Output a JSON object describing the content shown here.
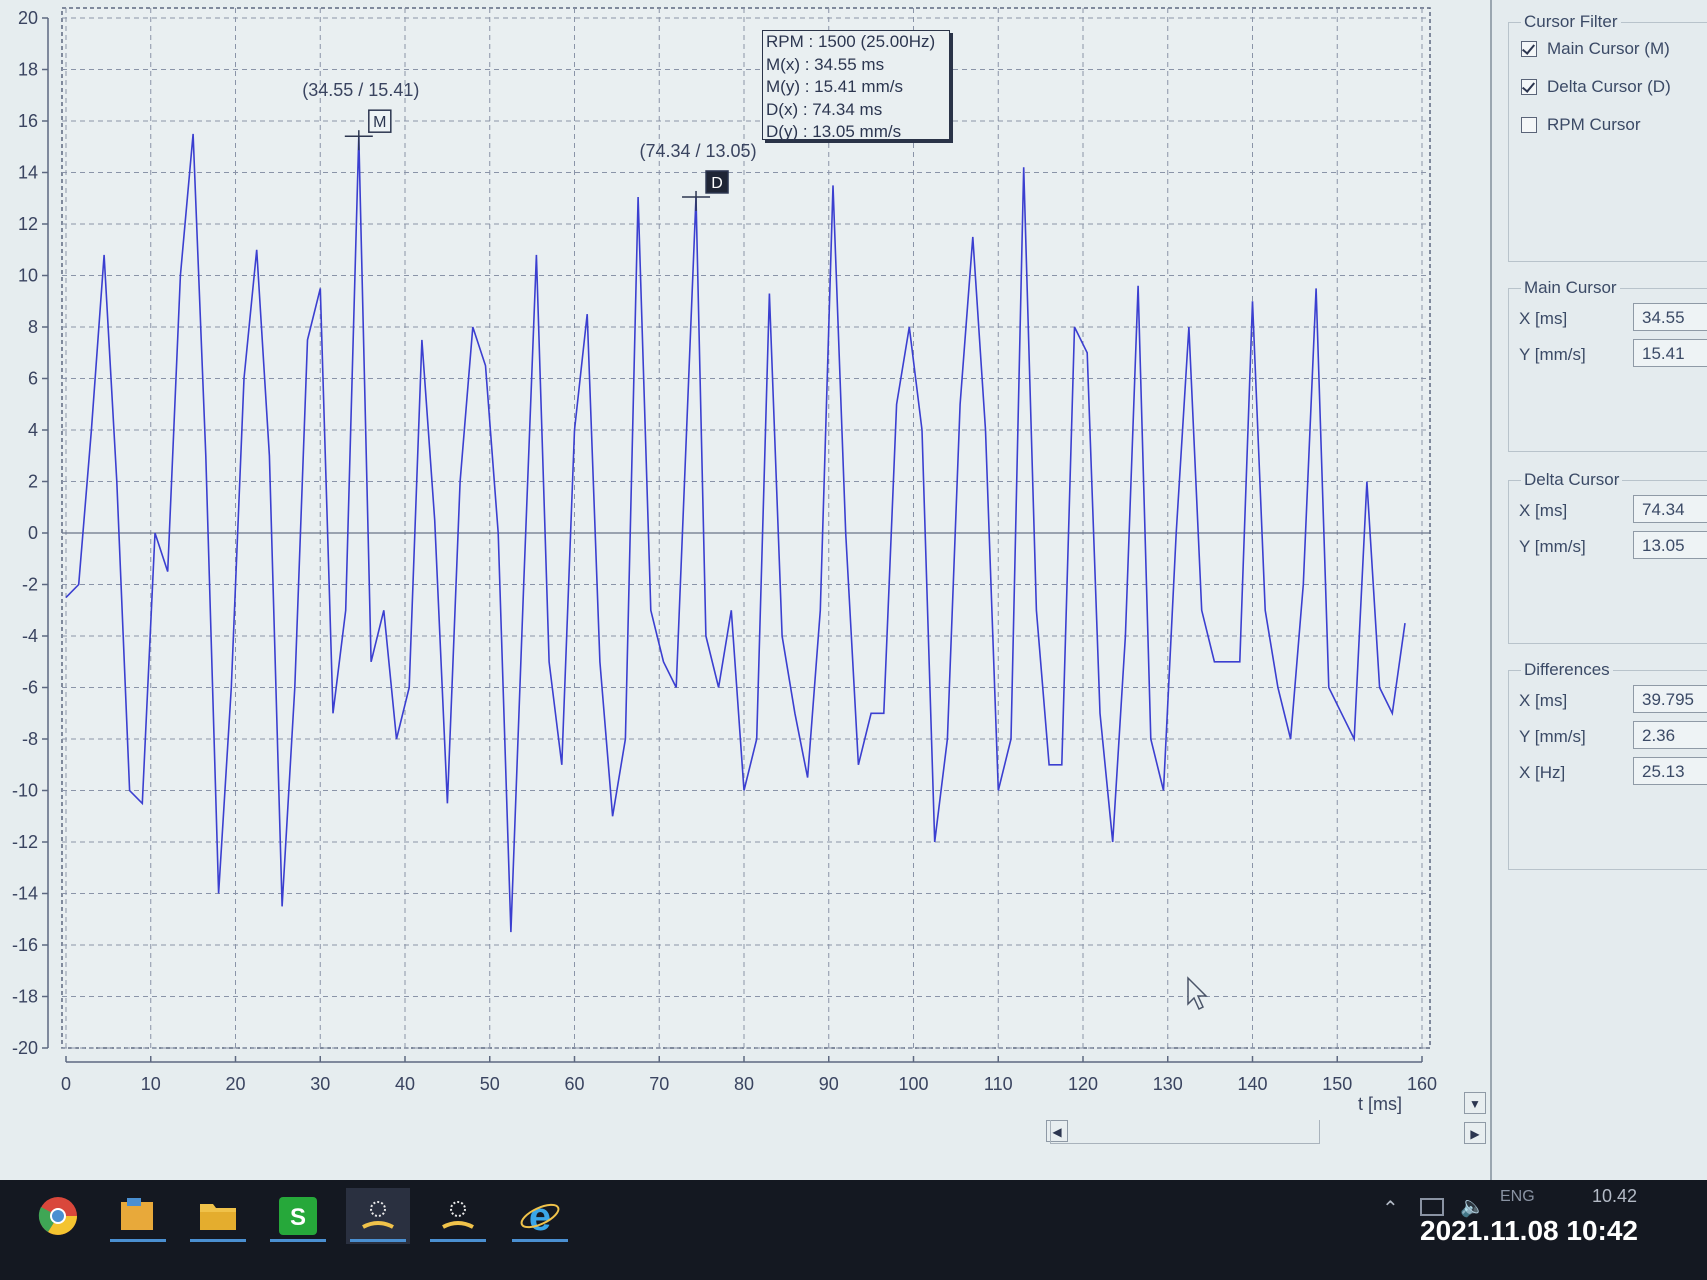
{
  "chart_data": {
    "type": "line",
    "xlabel": "t [ms]",
    "xlim": [
      0,
      160
    ],
    "ylim": [
      -20,
      20
    ],
    "x_ticks": [
      0,
      10,
      20,
      30,
      40,
      50,
      60,
      70,
      80,
      90,
      100,
      110,
      120,
      130,
      140,
      150,
      160
    ],
    "y_ticks": [
      20,
      18,
      16,
      14,
      12,
      10,
      8,
      6,
      4,
      2,
      0,
      -2,
      -4,
      -6,
      -8,
      -10,
      -12,
      -14,
      -16,
      -18,
      -20
    ],
    "grid": true,
    "line_color": "#3b3fd0",
    "x": [
      0,
      1.5,
      3,
      4.5,
      6,
      7.5,
      9,
      10.5,
      12,
      13.5,
      15,
      16.5,
      18,
      19.5,
      21,
      22.5,
      24,
      25.5,
      27,
      28.5,
      30,
      31.5,
      33,
      34.55,
      36,
      37.5,
      39,
      40.5,
      42,
      43.5,
      45,
      46.5,
      48,
      49.5,
      51,
      52.5,
      54,
      55.5,
      57,
      58.5,
      60,
      61.5,
      63,
      64.5,
      66,
      67.5,
      69,
      70.5,
      72,
      74.34,
      75.5,
      77,
      78.5,
      80,
      81.5,
      83,
      84.5,
      86,
      87.5,
      89,
      90.5,
      92,
      93.5,
      95,
      96.5,
      98,
      99.5,
      101,
      102.5,
      104,
      105.5,
      107,
      108.5,
      110,
      111.5,
      113,
      114.5,
      116,
      117.5,
      119,
      120.5,
      122,
      123.5,
      125,
      126.5,
      128,
      129.5,
      131,
      132.5,
      134,
      135.5,
      137,
      138.5,
      140,
      141.5,
      143,
      144.5,
      146,
      147.5,
      149,
      150.5,
      152,
      153.5,
      155,
      156.5,
      158,
      159.5,
      160
    ],
    "y": [
      -2.5,
      -2,
      4,
      10.8,
      2,
      -10,
      -10.5,
      0,
      -1.5,
      10,
      15.5,
      3,
      -14,
      -6,
      6,
      11,
      3,
      -14.5,
      -6,
      7.5,
      9.5,
      -7,
      -3,
      15.41,
      -5,
      -3,
      -8,
      -6,
      7.5,
      0.5,
      -10.5,
      2,
      8,
      6.5,
      0,
      -15.5,
      -2,
      10.8,
      -5,
      -9,
      4,
      8.5,
      -5,
      -11,
      -8,
      13.05,
      -3,
      -5,
      -6,
      13.05,
      -4,
      -6,
      -3,
      -10,
      -8,
      9.3,
      -4,
      -7,
      -9.5,
      -3,
      13.5,
      0,
      -9,
      -7,
      -7,
      5,
      8,
      4,
      -12,
      -8,
      5,
      11.5,
      4,
      -10,
      -8,
      14.2,
      -3,
      -9,
      -9,
      8,
      7,
      -7,
      -12,
      -4,
      9.6,
      -8,
      -10,
      0,
      8,
      -3,
      -5,
      -5,
      -5,
      9,
      -3,
      -6,
      -8,
      -2,
      9.5,
      -6,
      -7,
      -8,
      2,
      -6,
      -7,
      -3.5
    ],
    "annotations": [
      {
        "label": "(34.55 / 15.41)",
        "marker": "M",
        "x": 34.55,
        "y": 15.41
      },
      {
        "label": "(74.34 / 13.05)",
        "marker": "D",
        "x": 74.34,
        "y": 13.05
      }
    ]
  },
  "info_box": {
    "rpm": "RPM : 1500 (25.00Hz)",
    "mx": "M(x) : 34.55 ms",
    "my": "M(y) : 15.41 mm/s",
    "dx": "D(x) : 74.34 ms",
    "dy": "D(y) : 13.05 mm/s"
  },
  "cursor_filter": {
    "title": "Cursor Filter",
    "main_cursor": {
      "label": "Main Cursor (M)",
      "checked": true
    },
    "delta_cursor": {
      "label": "Delta Cursor (D)",
      "checked": true
    },
    "rpm_cursor": {
      "label": "RPM Cursor",
      "checked": false
    }
  },
  "main_cursor": {
    "title": "Main Cursor",
    "x_label": "X [ms]",
    "x_value": "34.55",
    "y_label": "Y [mm/s]",
    "y_value": "15.41"
  },
  "delta_cursor": {
    "title": "Delta Cursor",
    "x_label": "X [ms]",
    "x_value": "74.34",
    "y_label": "Y [mm/s]",
    "y_value": "13.05"
  },
  "differences": {
    "title": "Differences",
    "x_label": "X [ms]",
    "x_value": "39.795",
    "y_label": "Y [mm/s]",
    "y_value": "2.36",
    "hz_label": "X [Hz]",
    "hz_value": "25.13"
  },
  "taskbar": {
    "apps": [
      "chrome-icon",
      "file-manager-icon",
      "folder-icon",
      "spreadsheet-icon",
      "analyzer-app-icon",
      "analyzer-app-2-icon",
      "internet-explorer-icon"
    ],
    "tray_lang": "ENG",
    "clock": "10.42"
  },
  "photo_timestamp": "2021.11.08 10:42"
}
